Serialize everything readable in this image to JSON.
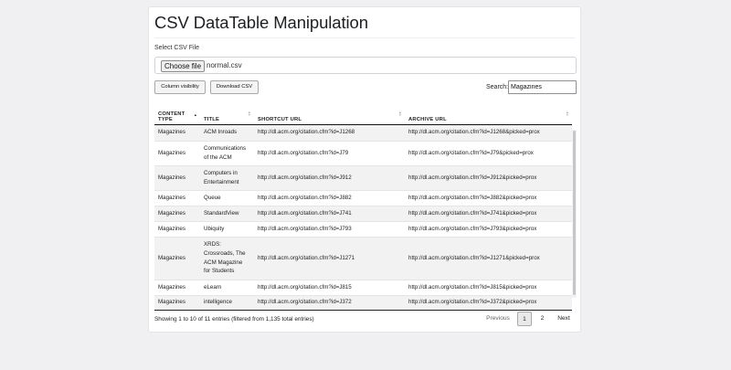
{
  "page": {
    "title": "CSV DataTable Manipulation",
    "file_label": "Select CSV File",
    "choose_file_label": "Choose file",
    "file_name": "normal.csv"
  },
  "toolbar": {
    "column_visibility_label": "Column visibility",
    "download_label": "Download CSV",
    "search_label": "Search:",
    "search_value": "Magazines"
  },
  "table": {
    "columns": [
      {
        "label": "CONTENT TYPE",
        "sort": "asc"
      },
      {
        "label": "TITLE",
        "sort": "none"
      },
      {
        "label": "SHORTCUT URL",
        "sort": "none"
      },
      {
        "label": "ARCHIVE URL",
        "sort": "none"
      }
    ],
    "rows": [
      [
        "Magazines",
        "ACM Inroads",
        "http://dl.acm.org/citation.cfm?id=J1268",
        "http://dl.acm.org/citation.cfm?id=J1268&picked=prox"
      ],
      [
        "Magazines",
        "Communications of the ACM",
        "http://dl.acm.org/citation.cfm?id=J79",
        "http://dl.acm.org/citation.cfm?id=J79&picked=prox"
      ],
      [
        "Magazines",
        "Computers in Entertainment",
        "http://dl.acm.org/citation.cfm?id=J912",
        "http://dl.acm.org/citation.cfm?id=J912&picked=prox"
      ],
      [
        "Magazines",
        "Queue",
        "http://dl.acm.org/citation.cfm?id=J882",
        "http://dl.acm.org/citation.cfm?id=J882&picked=prox"
      ],
      [
        "Magazines",
        "StandardView",
        "http://dl.acm.org/citation.cfm?id=J741",
        "http://dl.acm.org/citation.cfm?id=J741&picked=prox"
      ],
      [
        "Magazines",
        "Ubiquity",
        "http://dl.acm.org/citation.cfm?id=J793",
        "http://dl.acm.org/citation.cfm?id=J793&picked=prox"
      ],
      [
        "Magazines",
        "XRDS: Crossroads, The ACM Magazine for Students",
        "http://dl.acm.org/citation.cfm?id=J1271",
        "http://dl.acm.org/citation.cfm?id=J1271&picked=prox"
      ],
      [
        "Magazines",
        "eLearn",
        "http://dl.acm.org/citation.cfm?id=J815",
        "http://dl.acm.org/citation.cfm?id=J815&picked=prox"
      ],
      [
        "Magazines",
        "intelligence",
        "http://dl.acm.org/citation.cfm?id=J372",
        "http://dl.acm.org/citation.cfm?id=J372&picked=prox"
      ]
    ]
  },
  "footer": {
    "info": "Showing 1 to 10 of 11 entries (filtered from 1,135 total entries)",
    "previous_label": "Previous",
    "page_1": "1",
    "page_2": "2",
    "next_label": "Next"
  }
}
